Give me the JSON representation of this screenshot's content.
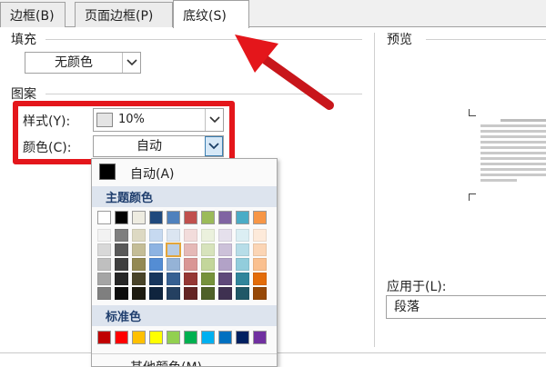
{
  "tabs": [
    {
      "label": "边框(B)"
    },
    {
      "label": "页面边框(P)"
    },
    {
      "label": "底纹(S)"
    }
  ],
  "fill": {
    "label": "填充",
    "value": "无颜色"
  },
  "pattern": {
    "label": "图案",
    "style_label": "样式(Y):",
    "style_value": "10%",
    "color_label": "颜色(C):",
    "color_value": "自动"
  },
  "preview": {
    "label": "预览",
    "apply_label": "应用于(L):",
    "apply_value": "段落"
  },
  "palette": {
    "auto_label": "自动(A)",
    "theme_header": "主题颜色",
    "standard_header": "标准色",
    "more_label": "其他颜色(M)...",
    "theme_top": [
      "#ffffff",
      "#000000",
      "#eeece1",
      "#1f497d",
      "#4f81bd",
      "#c0504d",
      "#9bbb59",
      "#8064a2",
      "#4bacc6",
      "#f79646"
    ],
    "theme_shades": [
      [
        "#f2f2f2",
        "#7f7f7f",
        "#ddd9c3",
        "#c6d9f0",
        "#dbe5f1",
        "#f2dcdb",
        "#ebf1dd",
        "#e5e0ec",
        "#dbeef3",
        "#fdeada"
      ],
      [
        "#d8d8d8",
        "#595959",
        "#c4bd97",
        "#8db3e2",
        "#b8cce4",
        "#e5b9b7",
        "#d7e3bc",
        "#ccc1d9",
        "#b7dde8",
        "#fbd5b5"
      ],
      [
        "#bfbfbf",
        "#3f3f3f",
        "#938953",
        "#548dd4",
        "#95b3d7",
        "#d99694",
        "#c3d69b",
        "#b2a2c7",
        "#92cddc",
        "#fac08f"
      ],
      [
        "#a5a5a5",
        "#262626",
        "#494429",
        "#17365d",
        "#366092",
        "#953734",
        "#76923c",
        "#5f497a",
        "#31859b",
        "#e36c09"
      ],
      [
        "#7f7f7f",
        "#0c0c0c",
        "#1d1b10",
        "#0f243e",
        "#244061",
        "#632423",
        "#4f6128",
        "#3f3151",
        "#205867",
        "#974806"
      ]
    ],
    "standard": [
      "#c00000",
      "#ff0000",
      "#ffc000",
      "#ffff00",
      "#92d050",
      "#00b050",
      "#00b0f0",
      "#0070c0",
      "#002060",
      "#7030a0"
    ]
  }
}
